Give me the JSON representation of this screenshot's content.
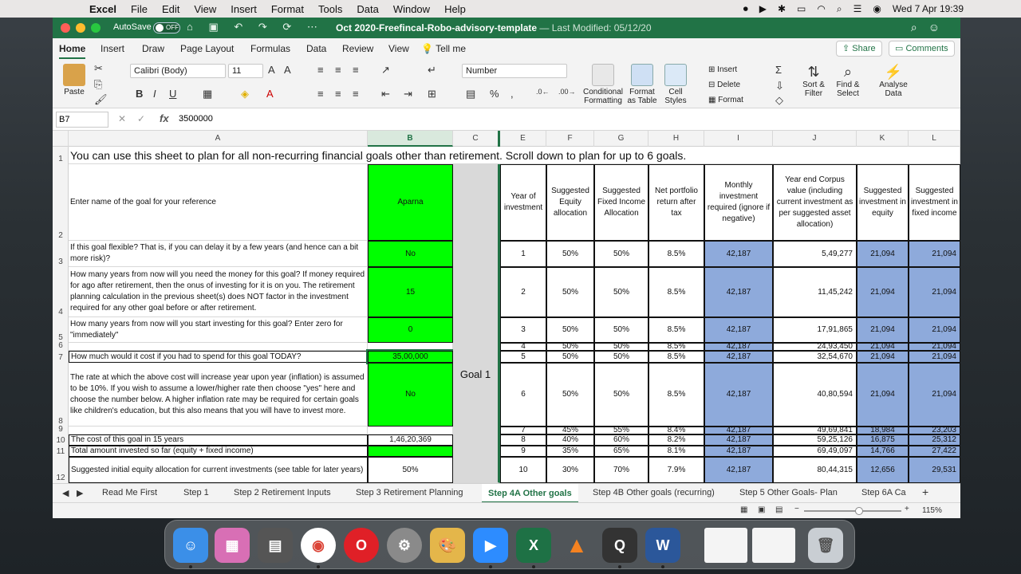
{
  "menubar": {
    "app": "Excel",
    "items": [
      "File",
      "Edit",
      "View",
      "Insert",
      "Format",
      "Tools",
      "Data",
      "Window",
      "Help"
    ],
    "clock": "Wed 7 Apr  19:39"
  },
  "titlebar": {
    "autosave": "AutoSave",
    "toggle": "OFF",
    "doc_title": "Oct 2020-Freefincal-Robo-advisory-template",
    "last_modified": "— Last Modified: 05/12/20"
  },
  "ribbon_tabs": [
    "Home",
    "Insert",
    "Draw",
    "Page Layout",
    "Formulas",
    "Data",
    "Review",
    "View",
    "Tell me"
  ],
  "share": "Share",
  "comments": "Comments",
  "ribbon": {
    "paste": "Paste",
    "font": "Calibri (Body)",
    "size": "11",
    "number_format": "Number",
    "cond_fmt": "Conditional Formatting",
    "fmt_table": "Format as Table",
    "cell_styles": "Cell Styles",
    "insert": "Insert",
    "delete": "Delete",
    "format": "Format",
    "sort": "Sort & Filter",
    "find": "Find & Select",
    "analyse": "Analyse Data"
  },
  "formula": {
    "cell": "B7",
    "value": "3500000"
  },
  "columns": [
    "A",
    "B",
    "C",
    "E",
    "F",
    "G",
    "H",
    "I",
    "J",
    "K",
    "L"
  ],
  "rows": [
    "1",
    "2",
    "3",
    "4",
    "5",
    "6",
    "7",
    "8",
    "9",
    "10",
    "11",
    "12"
  ],
  "row1": "You can use this sheet to plan for all non-recurring financial goals other than retirement. Scroll down to plan for up to 6 goals.",
  "questions": {
    "r2": "Enter name of the goal for your reference",
    "r3": "If this goal flexible? That is, if you can delay it by a few years (and hence can a bit more risk)?",
    "r4": "How many years from now will you need the money for this goal?  If money required for ago after retirement, then the onus of investing for it is on you. The retirement planning calculation in the previous sheet(s) does NOT factor in the investment required for any other goal before or after retirement.",
    "r5": "How many years from now will you start investing for this goal? Enter zero for \"immediately\"",
    "r7": "How much would it cost if you had to spend for this goal TODAY?",
    "r8": "The rate at which the above cost will increase year upon year (inflation) is assumed to be 10%. If you wish to assume a lower/higher rate then choose \"yes\" here and choose the number below. A higher inflation rate may be required for certain goals like children's education, but this also means that you will have to invest more.",
    "r10": "The cost of this goal in 15 years",
    "r11": "Total amount invested so far (equity + fixed income)",
    "r12": "Suggested initial equity allocation for current investments (see table for later years)"
  },
  "answers": {
    "r2": "Aparna",
    "r3": "No",
    "r4": "15",
    "r5": "0",
    "r7": "35,00,000",
    "r8": "No",
    "r10": "1,46,20,369",
    "r11": "",
    "r12": "50%"
  },
  "goal_label": "Goal 1",
  "table_headers": {
    "E": "Year of investment",
    "F": "Suggested Equity allocation",
    "G": "Suggested Fixed Income Allocation",
    "H": "Net portfolio return after tax",
    "I": "Monthly investment required (ignore if negative)",
    "J": "Year end Corpus value (including current investment as per suggested asset allocation)",
    "K": "Suggested investment in equity",
    "L": "Suggested investment in fixed income"
  },
  "table_rows": [
    {
      "year": "1",
      "eq": "50%",
      "fi": "50%",
      "ret": "8.5%",
      "monthly": "42,187",
      "corpus": "5,49,277",
      "ieq": "21,094",
      "ifi": "21,094"
    },
    {
      "year": "2",
      "eq": "50%",
      "fi": "50%",
      "ret": "8.5%",
      "monthly": "42,187",
      "corpus": "11,45,242",
      "ieq": "21,094",
      "ifi": "21,094"
    },
    {
      "year": "3",
      "eq": "50%",
      "fi": "50%",
      "ret": "8.5%",
      "monthly": "42,187",
      "corpus": "17,91,865",
      "ieq": "21,094",
      "ifi": "21,094"
    },
    {
      "year": "4",
      "eq": "50%",
      "fi": "50%",
      "ret": "8.5%",
      "monthly": "42,187",
      "corpus": "24,93,450",
      "ieq": "21,094",
      "ifi": "21,094"
    },
    {
      "year": "5",
      "eq": "50%",
      "fi": "50%",
      "ret": "8.5%",
      "monthly": "42,187",
      "corpus": "32,54,670",
      "ieq": "21,094",
      "ifi": "21,094"
    },
    {
      "year": "6",
      "eq": "50%",
      "fi": "50%",
      "ret": "8.5%",
      "monthly": "42,187",
      "corpus": "40,80,594",
      "ieq": "21,094",
      "ifi": "21,094"
    },
    {
      "year": "7",
      "eq": "45%",
      "fi": "55%",
      "ret": "8.4%",
      "monthly": "42,187",
      "corpus": "49,69,841",
      "ieq": "18,984",
      "ifi": "23,203"
    },
    {
      "year": "8",
      "eq": "40%",
      "fi": "60%",
      "ret": "8.2%",
      "monthly": "42,187",
      "corpus": "59,25,126",
      "ieq": "16,875",
      "ifi": "25,312"
    },
    {
      "year": "9",
      "eq": "35%",
      "fi": "65%",
      "ret": "8.1%",
      "monthly": "42,187",
      "corpus": "69,49,097",
      "ieq": "14,766",
      "ifi": "27,422"
    },
    {
      "year": "10",
      "eq": "30%",
      "fi": "70%",
      "ret": "7.9%",
      "monthly": "42,187",
      "corpus": "80,44,315",
      "ieq": "12,656",
      "ifi": "29,531"
    }
  ],
  "sheet_tabs": [
    "Read Me First",
    "Step 1",
    "Step 2 Retirement Inputs",
    "Step 3 Retirement Planning",
    "Step 4A Other goals",
    "Step 4B Other goals (recurring)",
    "Step 5 Other Goals- Plan",
    "Step 6A Ca"
  ],
  "zoom": "115%",
  "colors": {
    "excel_green": "#217346",
    "input_green": "#00ff00",
    "calc_blue": "#8eaadb"
  }
}
